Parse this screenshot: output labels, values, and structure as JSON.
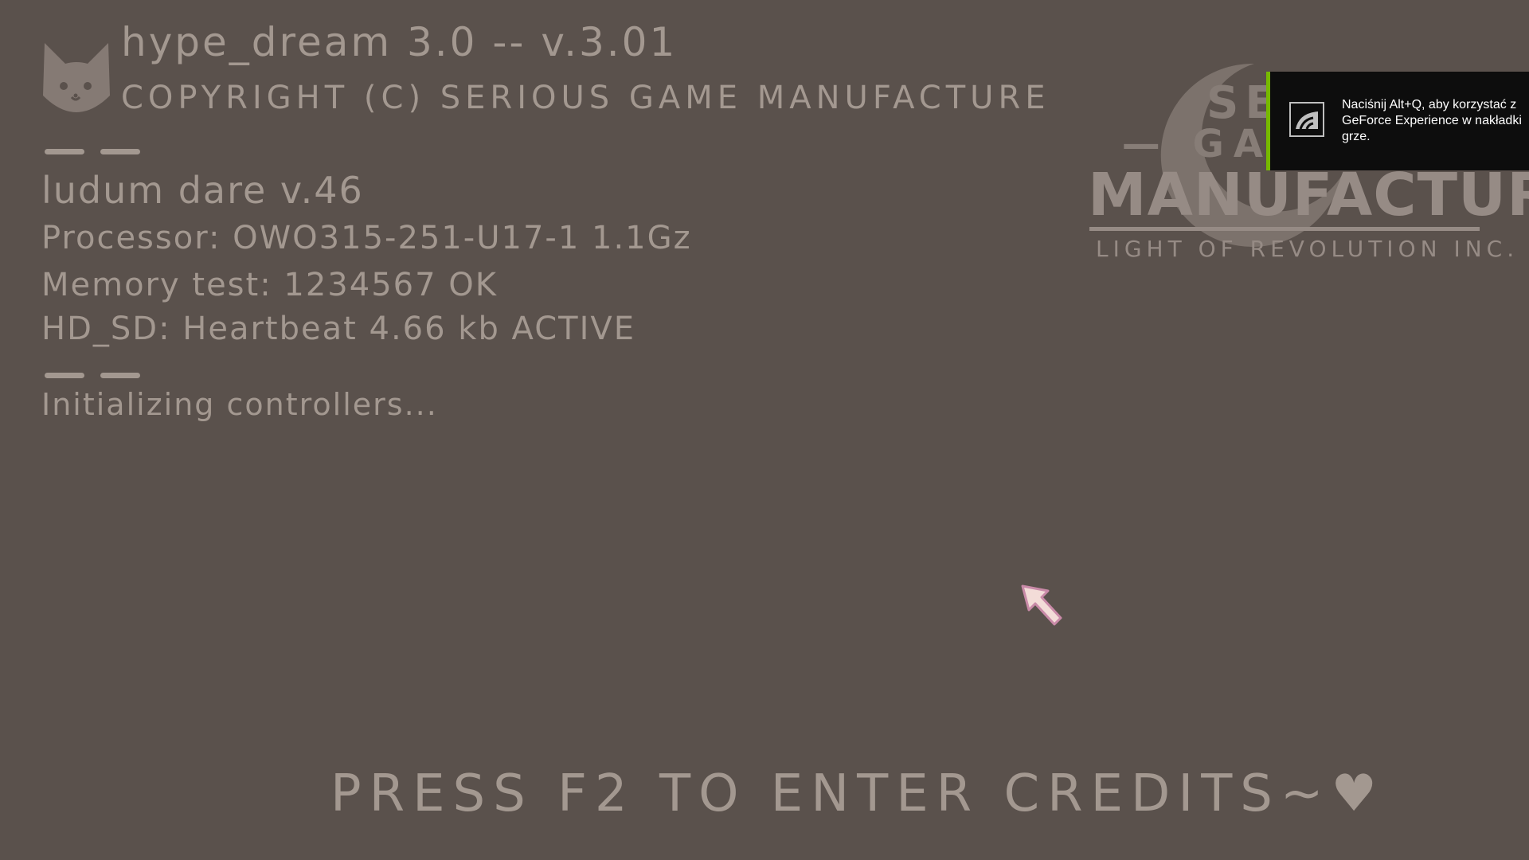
{
  "bios": {
    "title": "hype_dream 3.0 -- v.3.01",
    "copyright": "COPYRIGHT (C) SERIOUS GAME MANUFACTURE",
    "game": "ludum dare v.46",
    "processor": "Processor: OWO315-251-U17-1  1.1Gz",
    "memory": "Memory test: 1234567 OK",
    "hd": "HD_SD: Heartbeat  4.66 kb ACTIVE",
    "status": "Initializing controllers..."
  },
  "watermark": {
    "line1": "SERIOUS",
    "line2": "— GAME —",
    "line3": "MANUFACTURE",
    "line4": "LIGHT OF REVOLUTION INC."
  },
  "notification": {
    "text": "Naciśnij Alt+Q, aby korzystać z GeForce Experience w nakładki grze.",
    "accent": "#76b900",
    "icon": "geforce-logo-icon"
  },
  "prompt": {
    "text": "PRESS F2 TO ENTER CREDITS~♥"
  },
  "colors": {
    "background": "#5a514c",
    "text": "#a39890",
    "cursor": "#f3dcd8"
  }
}
